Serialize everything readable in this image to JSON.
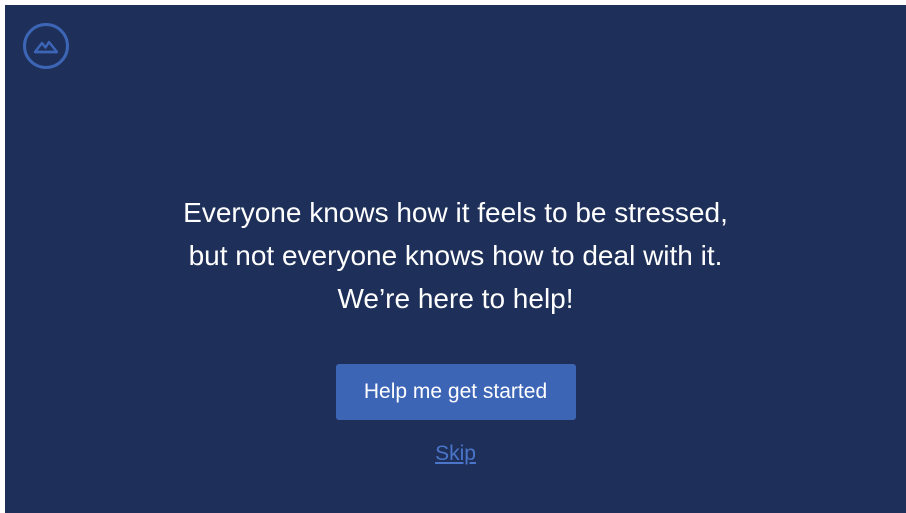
{
  "logo": {
    "icon": "mountain-circle-icon",
    "color": "#3d65b6"
  },
  "message": {
    "line1": "Everyone knows how it feels to be stressed,",
    "line2": "but not everyone knows how to deal with it.",
    "line3": "We’re here to help!"
  },
  "actions": {
    "primary_label": "Help me get started",
    "skip_label": "Skip"
  },
  "colors": {
    "background": "#1e3059",
    "accent": "#3d65b6",
    "link": "#4a75c9",
    "text": "#ffffff"
  }
}
